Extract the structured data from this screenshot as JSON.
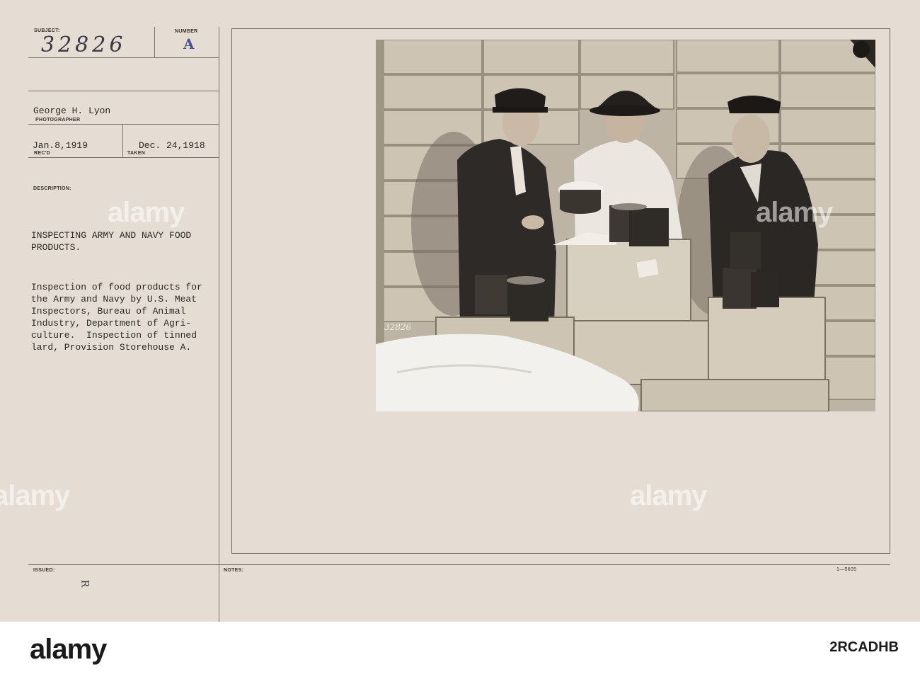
{
  "card": {
    "subject_label": "SUBJECT:",
    "subject_number": "32826",
    "number_label": "NUMBER",
    "number_value": "A",
    "photographer_name": "George H. Lyon",
    "photographer_label": "PHOTOGRAPHER",
    "received_date": "Jan.8,1919",
    "received_label": "REC'D",
    "taken_date": "Dec. 24,1918",
    "taken_label": "TAKEN",
    "description_label": "DESCRIPTION:",
    "title_line1": "INSPECTING ARMY AND NAVY FOOD",
    "title_line2": "PRODUCTS.",
    "desc_lines": [
      "Inspection of food products for",
      "the Army and Navy by U.S. Meat",
      "Inspectors, Bureau of Animal",
      "Industry, Department of Agri-",
      "culture.  Inspection of tinned",
      "lard, Provision Storehouse A."
    ],
    "issued_label": "ISSUED:",
    "issued_mark": "R",
    "notes_label": "NOTES:",
    "form_number": "1—5605"
  },
  "photo": {
    "negative_number": "32826"
  },
  "watermark": {
    "text": "alamy"
  },
  "footer": {
    "logo": "alamy",
    "image_id": "2RCADHB"
  }
}
